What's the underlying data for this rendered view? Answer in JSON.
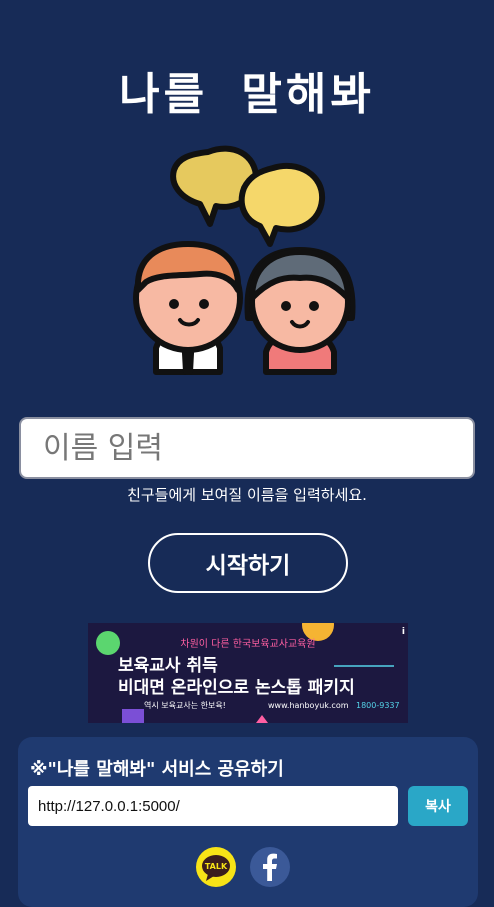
{
  "app": {
    "title": "나를 말해봐"
  },
  "name_input": {
    "placeholder": "이름 입력",
    "value": ""
  },
  "hint": "친구들에게 보여질 이름을 입력하세요.",
  "start_button": "시작하기",
  "ad": {
    "line1": "차원이 다른 한국보육교사교육원",
    "line2": "보육교사 취득",
    "line3": "비대면 온라인으로 논스톱 패키지",
    "line4": "역시 보육교사는 한보육!",
    "url": "www.hanboyuk.com",
    "phone": "1800-9337",
    "info": "i"
  },
  "share": {
    "title": "※\"나를 말해봐\" 서비스 공유하기",
    "url_value": "http://127.0.0.1:5000/",
    "copy_label": "복사",
    "kakao_label": "TALK",
    "facebook_icon": "facebook-icon",
    "kakao_icon": "kakaotalk-icon"
  },
  "colors": {
    "background": "#172b57",
    "share_box": "#1f3a70",
    "copy_button": "#2aa7c7",
    "kakao": "#f7e317",
    "facebook": "#3b5998"
  }
}
